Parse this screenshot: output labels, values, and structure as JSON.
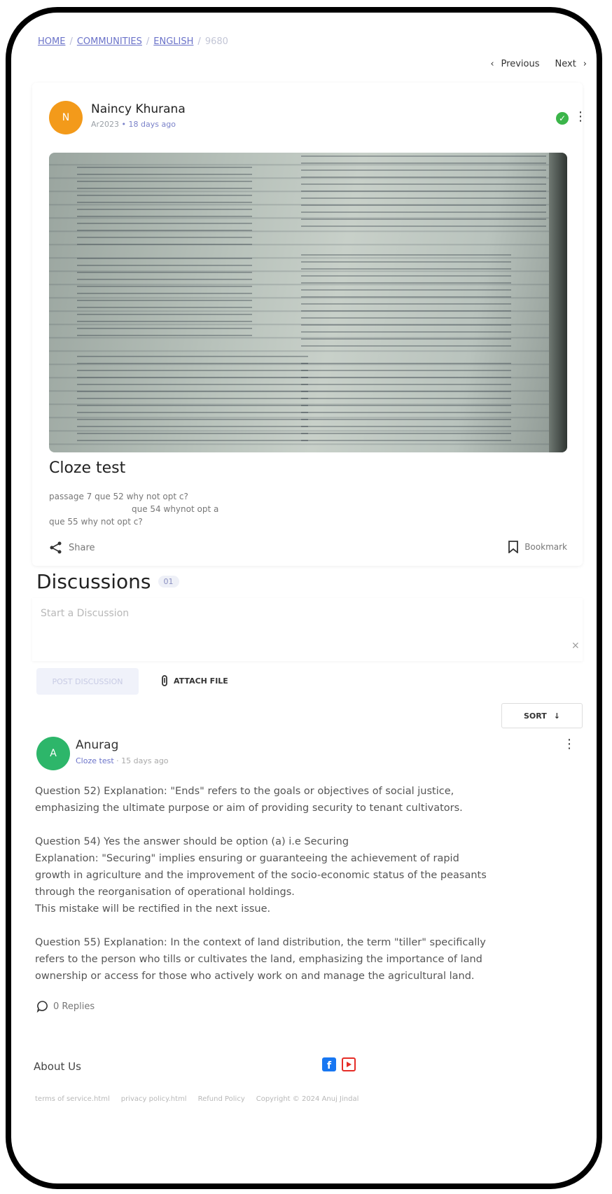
{
  "breadcrumb": {
    "home": "HOME",
    "communities": "COMMUNITIES",
    "english": "ENGLISH",
    "current": "9680"
  },
  "pager": {
    "previous": "Previous",
    "next": "Next"
  },
  "post": {
    "author_initial": "N",
    "author": "Naincy Khurana",
    "meta_user": "Ar2023",
    "meta_time": "18 days ago",
    "title": "Cloze test",
    "body_lines": [
      "passage 7 que 52 why not opt c?",
      "que 54 whynot opt a",
      "que 55 why not opt c?"
    ],
    "share": "Share",
    "bookmark": "Bookmark"
  },
  "discussions": {
    "title": "Discussions",
    "count": "01",
    "placeholder": "Start a Discussion",
    "clear": "×",
    "post_button": "POST DISCUSSION",
    "attach": "ATTACH FILE",
    "sort": "SORT"
  },
  "reply": {
    "initial": "A",
    "name": "Anurag",
    "tag": "Cloze test",
    "time": "· 15 days ago",
    "paragraphs": [
      [
        "Question 52) Explanation: \"Ends\" refers to the goals or objectives of social justice,",
        "emphasizing the ultimate purpose or aim of providing security to tenant cultivators."
      ],
      [
        "Question 54) Yes the answer should be option (a) i.e Securing",
        "Explanation: \"Securing\" implies ensuring or guaranteeing the achievement of rapid",
        "growth in agriculture and the improvement of the socio-economic status of the peasants",
        "through the reorganisation of operational holdings.",
        "This mistake will be rectified in the next issue."
      ],
      [
        "Question 55) Explanation: In the context of land distribution, the term \"tiller\" specifically",
        "refers to the person who tills or cultivates the land, emphasizing the importance of land",
        "ownership or access for those who actively work on and manage the agricultural land."
      ]
    ],
    "replies": "0 Replies"
  },
  "footer": {
    "about": "About Us",
    "links": [
      "terms of service.html",
      "privacy policy.html",
      "Refund Policy",
      "Copyright © 2024 Anuj Jindal"
    ]
  },
  "colors": {
    "accent": "#6b73c9",
    "author_avatar": "#f39a1a",
    "reply_avatar": "#2db66a",
    "verified": "#3bb54a"
  },
  "icons": [
    "chevron-left-icon",
    "chevron-right-icon",
    "check-circle-icon",
    "kebab-menu-icon",
    "share-icon",
    "bookmark-icon",
    "paperclip-icon",
    "arrow-down-icon",
    "comment-icon",
    "facebook-icon",
    "youtube-icon"
  ]
}
